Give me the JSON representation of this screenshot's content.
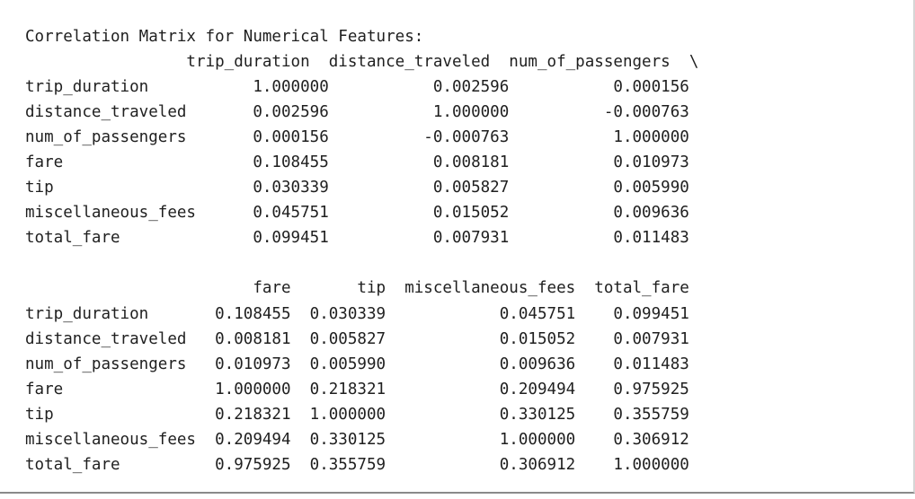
{
  "output": {
    "title": "Correlation Matrix for Numerical Features:",
    "block1": {
      "header": "                 trip_duration  distance_traveled  num_of_passengers  \\",
      "rows": [
        "trip_duration           1.000000           0.002596           0.000156",
        "distance_traveled       0.002596           1.000000          -0.000763",
        "num_of_passengers       0.000156          -0.000763           1.000000",
        "fare                    0.108455           0.008181           0.010973",
        "tip                     0.030339           0.005827           0.005990",
        "miscellaneous_fees      0.045751           0.015052           0.009636",
        "total_fare              0.099451           0.007931           0.011483"
      ]
    },
    "block2": {
      "header": "                        fare       tip  miscellaneous_fees  total_fare",
      "rows": [
        "trip_duration       0.108455  0.030339            0.045751    0.099451",
        "distance_traveled   0.008181  0.005827            0.015052    0.007931",
        "num_of_passengers   0.010973  0.005990            0.009636    0.011483",
        "fare                1.000000  0.218321            0.209494    0.975925",
        "tip                 0.218321  1.000000            0.330125    0.355759",
        "miscellaneous_fees  0.209494  0.330125            1.000000    0.306912",
        "total_fare          0.975925  0.355759            0.306912    1.000000"
      ]
    }
  }
}
